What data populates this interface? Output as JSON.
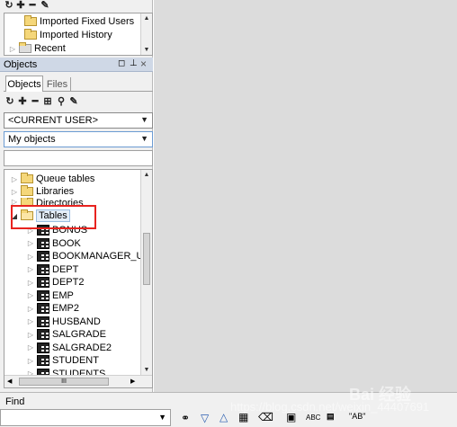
{
  "top_tree": {
    "items": [
      {
        "label": "Imported Fixed Users"
      },
      {
        "label": "Imported History"
      },
      {
        "label": "Recent"
      }
    ]
  },
  "objects_panel": {
    "title": "Objects",
    "tabs": [
      {
        "label": "Objects"
      },
      {
        "label": "Files"
      }
    ],
    "user_combo": {
      "value": "<CURRENT USER>"
    },
    "filter_combo": {
      "value": "My objects"
    },
    "search": {
      "value": ""
    }
  },
  "object_tree": {
    "folders": [
      {
        "label": "Queue tables"
      },
      {
        "label": "Libraries"
      },
      {
        "label": "Directories"
      },
      {
        "label": "Tables"
      }
    ],
    "tables": [
      {
        "label": "BONUS"
      },
      {
        "label": "BOOK"
      },
      {
        "label": "BOOKMANAGER_U"
      },
      {
        "label": "DEPT"
      },
      {
        "label": "DEPT2"
      },
      {
        "label": "EMP"
      },
      {
        "label": "EMP2"
      },
      {
        "label": "HUSBAND"
      },
      {
        "label": "SALGRADE"
      },
      {
        "label": "SALGRADE2"
      },
      {
        "label": "STUDENT"
      },
      {
        "label": "STUDENTS"
      }
    ],
    "hscroll_label": "III"
  },
  "find_bar": {
    "label": "Find",
    "input_value": "",
    "buttons": {
      "abc_label": "ABC",
      "ab_quote_label": "\"AB\""
    }
  },
  "watermark": {
    "url": "https://blog.csdn.net/weixin_44407691",
    "brand": "Bai 经验"
  },
  "colors": {
    "highlight_box": "#e8231f",
    "panel_header": "#cfd8e6",
    "background_right": "#dcdcdc"
  }
}
